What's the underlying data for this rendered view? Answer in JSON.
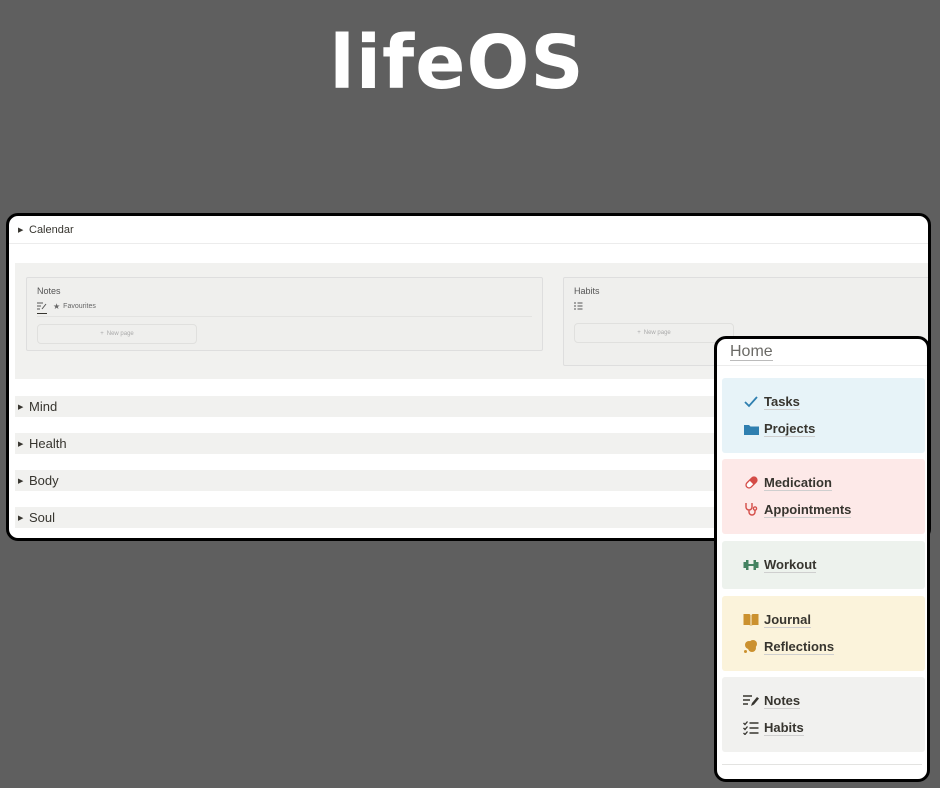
{
  "hero": {
    "title": "lifeOS"
  },
  "calendar": {
    "label": "Calendar"
  },
  "notes_box": {
    "title": "Notes",
    "view": "Favourites",
    "new_page": "New page"
  },
  "habits_box": {
    "title": "Habits",
    "new_page": "New page"
  },
  "sections": [
    {
      "label": "Mind"
    },
    {
      "label": "Health"
    },
    {
      "label": "Body"
    },
    {
      "label": "Soul"
    }
  ],
  "home": {
    "title": "Home",
    "cards": [
      {
        "bg": "#e7f3f8",
        "items": [
          {
            "label": "Tasks",
            "icon": "check-icon",
            "color": "#2f7fb0"
          },
          {
            "label": "Projects",
            "icon": "folder-icon",
            "color": "#2f7fb0"
          }
        ]
      },
      {
        "bg": "#fde9e8",
        "items": [
          {
            "label": "Medication",
            "icon": "pill-icon",
            "color": "#d44c47"
          },
          {
            "label": "Appointments",
            "icon": "stethoscope-icon",
            "color": "#d44c47"
          }
        ]
      },
      {
        "bg": "#edf2ed",
        "items": [
          {
            "label": "Workout",
            "icon": "dumbbell-icon",
            "color": "#448361"
          }
        ]
      },
      {
        "bg": "#fbf3db",
        "items": [
          {
            "label": "Journal",
            "icon": "book-icon",
            "color": "#cb912f"
          },
          {
            "label": "Reflections",
            "icon": "thought-bubble-icon",
            "color": "#cb912f"
          }
        ]
      },
      {
        "bg": "#f1f1ef",
        "items": [
          {
            "label": "Notes",
            "icon": "notes-icon",
            "color": "#37352f"
          },
          {
            "label": "Habits",
            "icon": "checklist-icon",
            "color": "#37352f"
          }
        ]
      }
    ]
  }
}
